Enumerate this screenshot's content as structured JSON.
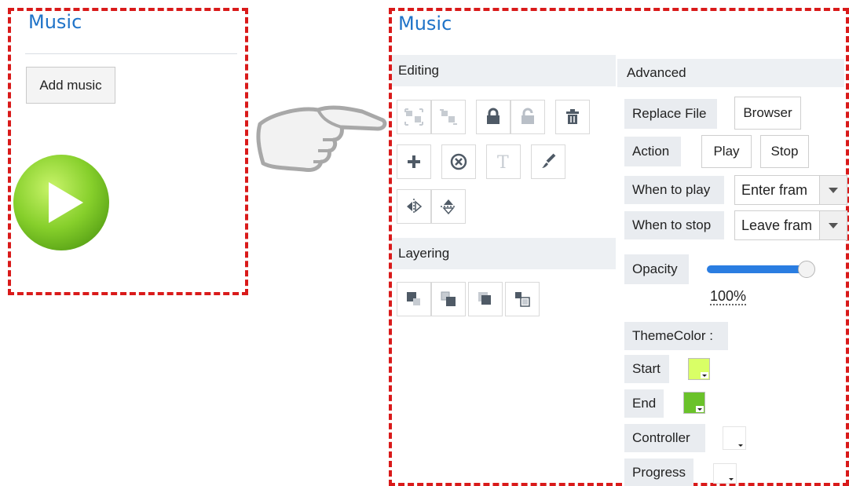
{
  "left_panel": {
    "title": "Music",
    "add_music_label": "Add music"
  },
  "right_panel": {
    "title": "Music",
    "editing": {
      "header": "Editing"
    },
    "layering": {
      "header": "Layering"
    },
    "advanced": {
      "header": "Advanced",
      "replace_file_label": "Replace File",
      "browser_button": "Browser",
      "action_label": "Action",
      "play_button": "Play",
      "stop_button": "Stop",
      "when_to_play_label": "When to play",
      "when_to_play_value": "Enter fram",
      "when_to_stop_label": "When to stop",
      "when_to_stop_value": "Leave fram",
      "opacity_label": "Opacity",
      "opacity_value": "100%",
      "opacity_level": 1.0,
      "theme_color_label": "ThemeColor :",
      "start_label": "Start",
      "end_label": "End",
      "controller_label": "Controller",
      "progress_label": "Progress"
    }
  },
  "colors": {
    "frame_border": "#d91a1a",
    "title_blue": "#1f73c8",
    "start_color": "#d9ff66",
    "end_color": "#6ac22a",
    "slider_fill": "#2a7de1"
  },
  "icons": {
    "play_badge": "play-icon",
    "pointer": "pointing-hand-icon"
  }
}
